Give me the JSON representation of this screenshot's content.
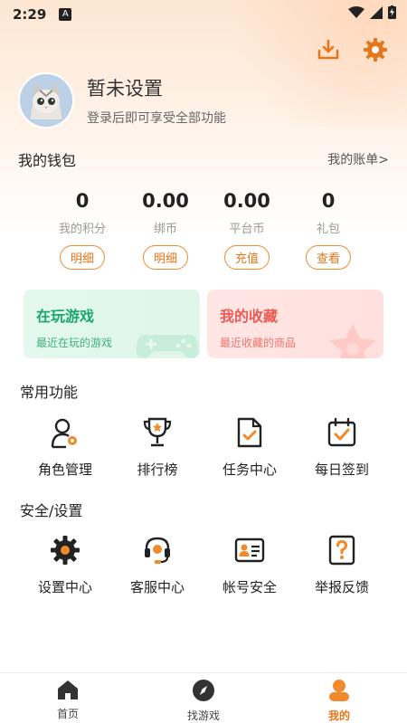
{
  "status_bar": {
    "time": "2:29",
    "a_badge": "A"
  },
  "top_actions": {
    "download_icon": "download-icon",
    "settings_icon": "gear-icon"
  },
  "profile": {
    "name": "暂未设置",
    "subtitle": "登录后即可享受全部功能"
  },
  "wallet": {
    "title": "我的钱包",
    "bill_link": "我的账单>",
    "stats": [
      {
        "value": "0",
        "label": "我的积分",
        "button": "明细"
      },
      {
        "value": "0.00",
        "label": "绑币",
        "button": "明细"
      },
      {
        "value": "0.00",
        "label": "平台币",
        "button": "充值"
      },
      {
        "value": "0",
        "label": "礼包",
        "button": "查看"
      }
    ]
  },
  "cards": [
    {
      "title": "在玩游戏",
      "subtitle": "最近在玩的游戏"
    },
    {
      "title": "我的收藏",
      "subtitle": "最近收藏的商品"
    }
  ],
  "common_functions": {
    "title": "常用功能",
    "items": [
      {
        "label": "角色管理",
        "icon": "role-manage-icon"
      },
      {
        "label": "排行榜",
        "icon": "trophy-icon"
      },
      {
        "label": "任务中心",
        "icon": "task-doc-icon"
      },
      {
        "label": "每日签到",
        "icon": "calendar-check-icon"
      }
    ]
  },
  "security_settings": {
    "title": "安全/设置",
    "items": [
      {
        "label": "设置中心",
        "icon": "gear-icon"
      },
      {
        "label": "客服中心",
        "icon": "headset-icon"
      },
      {
        "label": "帐号安全",
        "icon": "id-card-icon"
      },
      {
        "label": "举报反馈",
        "icon": "report-question-icon"
      }
    ]
  },
  "bottom_nav": {
    "items": [
      {
        "label": "首页",
        "icon": "home-icon"
      },
      {
        "label": "找游戏",
        "icon": "compass-icon"
      },
      {
        "label": "我的",
        "icon": "user-icon"
      }
    ]
  },
  "colors": {
    "accent": "#f08a2a",
    "green": "#1aa86a",
    "red": "#ee5a52"
  }
}
